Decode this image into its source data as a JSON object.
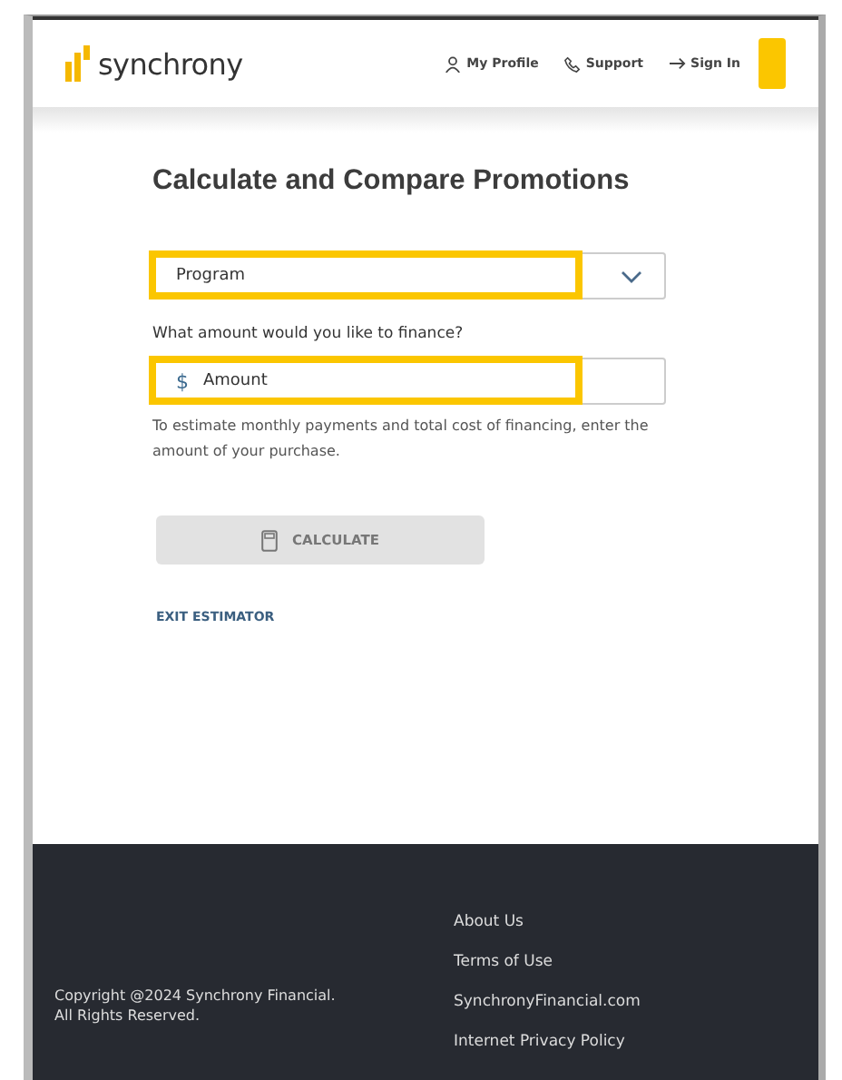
{
  "header": {
    "logo": "synchrony",
    "nav": [
      {
        "kind": "profile",
        "label": "My Profile"
      },
      {
        "kind": "support",
        "label": "Support"
      },
      {
        "kind": "signin",
        "label": "Sign In"
      }
    ]
  },
  "title": "Calculate and Compare Promotions",
  "program_select": {
    "placeholder": "Program",
    "highlighted": true
  },
  "amount": {
    "label": "What amount would you like to finance?",
    "currency": "$",
    "placeholder": "Amount",
    "highlighted": true,
    "help": "To estimate monthly payments and total cost of financing, enter the amount of your purchase."
  },
  "calculate_button": {
    "label": "CALCULATE",
    "disabled": true
  },
  "exit_link": "EXIT ESTIMATOR",
  "footer": {
    "copyright": [
      "Copyright @2024 Synchrony Financial.",
      "All Rights Reserved."
    ],
    "links": [
      "About Us",
      "Terms of Use",
      "SynchronyFinancial.com",
      "Internet Privacy Policy"
    ]
  }
}
